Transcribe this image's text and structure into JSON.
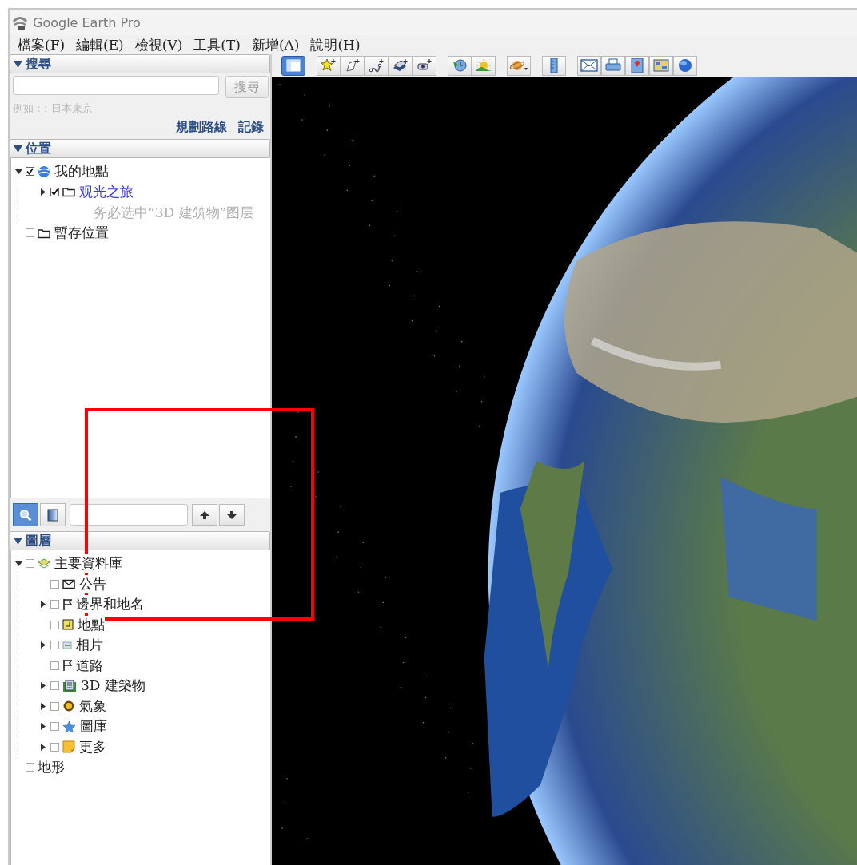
{
  "window": {
    "title": "Google Earth Pro"
  },
  "menu": [
    {
      "label": "檔案(F)"
    },
    {
      "label": "編輯(E)"
    },
    {
      "label": "檢視(V)"
    },
    {
      "label": "工具(T)"
    },
    {
      "label": "新增(A)"
    },
    {
      "label": "說明(H)"
    }
  ],
  "search_panel": {
    "title": "搜尋",
    "expanded": true,
    "search_button": {
      "label": "搜尋",
      "disabled": true
    },
    "hint": "例如：: 日本東京",
    "links": [
      "規劃路線",
      "記錄"
    ]
  },
  "places_panel": {
    "title": "位置",
    "expanded": true,
    "items": [
      {
        "label": "我的地點",
        "checked": true,
        "expanded": true,
        "children": [
          {
            "label": "观光之旅",
            "kind": "link",
            "checked": true,
            "expanded": false,
            "description": "务必选中“3D 建筑物”图层"
          }
        ]
      },
      {
        "label": "暫存位置",
        "checked": false
      }
    ]
  },
  "places_toolbar": {
    "buttons": [
      {
        "selected": true
      },
      {
        "selected": false
      }
    ]
  },
  "layers_panel": {
    "title": "圖層",
    "expanded": true,
    "items": [
      {
        "label": "主要資料庫",
        "checked": false,
        "expanded": true,
        "children": [
          {
            "label": "公告",
            "checked": false
          },
          {
            "label": "邊界和地名",
            "checked": false,
            "expanded": false
          },
          {
            "label": "地點",
            "checked": false
          },
          {
            "label": "相片",
            "checked": false,
            "expanded": false
          },
          {
            "label": "道路",
            "checked": false
          },
          {
            "label": "3D 建築物",
            "checked": false,
            "expanded": false
          },
          {
            "label": "氣象",
            "checked": false,
            "expanded": false
          },
          {
            "label": "圖庫",
            "checked": false,
            "expanded": false
          },
          {
            "label": "更多",
            "checked": false,
            "expanded": false
          }
        ]
      },
      {
        "label": "地形",
        "checked": false
      }
    ]
  },
  "toolbar": {
    "groups": [
      [
        {
          "selected": true
        }
      ],
      [
        {
          "selected": false
        },
        {
          "selected": false
        },
        {
          "selected": false
        },
        {
          "selected": false
        },
        {
          "selected": false
        }
      ],
      [
        {
          "selected": false
        },
        {
          "selected": false
        }
      ],
      [
        {
          "selected": false
        }
      ],
      [
        {
          "selected": false
        }
      ],
      [
        {
          "selected": false
        },
        {
          "selected": false
        },
        {
          "selected": false
        },
        {
          "selected": false
        },
        {
          "selected": false
        }
      ]
    ]
  }
}
